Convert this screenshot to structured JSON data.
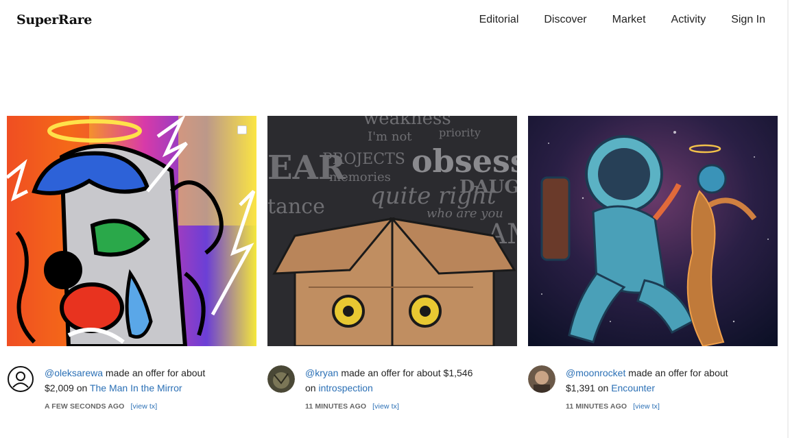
{
  "header": {
    "logo": "SuperRare",
    "nav": [
      "Editorial",
      "Discover",
      "Market",
      "Activity",
      "Sign In"
    ]
  },
  "cards": [
    {
      "user": "@oleksarewa",
      "action_pre": "made an offer for about",
      "price": "$2,009",
      "on": "on",
      "title": "The Man In the Mirror",
      "time": "A FEW SECONDS AGO",
      "tx": "[view tx]",
      "avatar_icon": "user-outline-icon"
    },
    {
      "user": "@kryan",
      "action_pre": "made an offer for about",
      "price": "$1,546",
      "on": "on",
      "title": "introspection",
      "time": "11 MINUTES AGO",
      "tx": "[view tx]",
      "avatar_icon": "photo-avatar"
    },
    {
      "user": "@moonrocket",
      "action_pre": "made an offer for about",
      "price": "$1,391",
      "on": "on",
      "title": "Encounter",
      "time": "11 MINUTES AGO",
      "tx": "[view tx]",
      "avatar_icon": "photo-avatar"
    }
  ],
  "art_words": {
    "card2": [
      "weakness",
      "I'm not",
      "priority",
      "PROJECTS",
      "obsessi",
      "memories",
      "DAUGH",
      "quite right",
      "who are you",
      "EAR",
      "tance",
      "AM"
    ]
  },
  "colors": {
    "link": "#2a6fb5",
    "text": "#222222",
    "muted": "#666666"
  }
}
